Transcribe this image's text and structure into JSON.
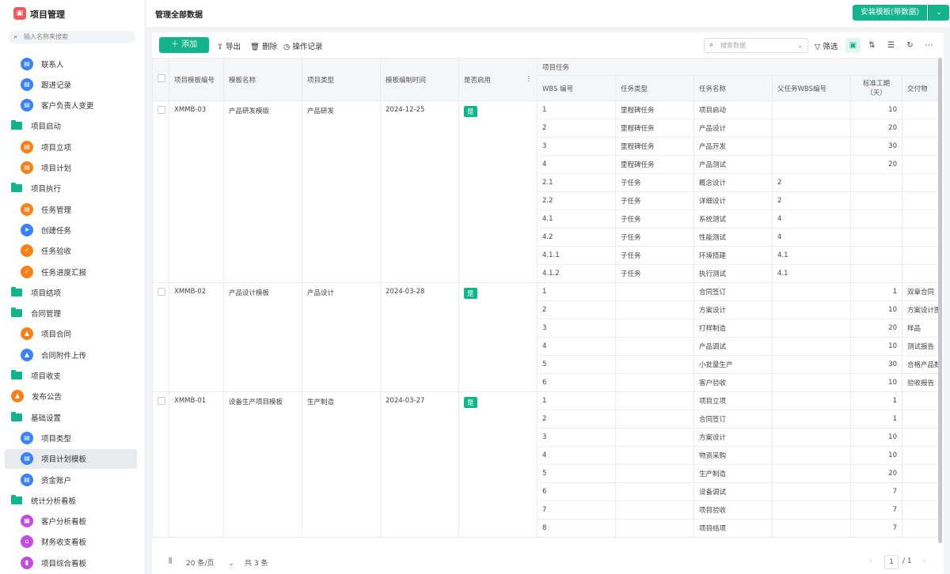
{
  "app": {
    "title": "项目管理",
    "logo_text": "▣"
  },
  "sidebar": {
    "search_placeholder": "输入名称来搜索",
    "items": [
      {
        "label": "联系人",
        "level": 1,
        "icon": "doc",
        "color": "#3b82f6"
      },
      {
        "label": "跟进记录",
        "level": 1,
        "icon": "doc",
        "color": "#3b82f6"
      },
      {
        "label": "客户负责人变更",
        "level": 1,
        "icon": "doc",
        "color": "#3b82f6"
      },
      {
        "label": "项目启动",
        "level": 0,
        "icon": "folder"
      },
      {
        "label": "项目立项",
        "level": 1,
        "icon": "doc",
        "color": "#f7821b"
      },
      {
        "label": "项目计划",
        "level": 1,
        "icon": "doc",
        "color": "#f7821b"
      },
      {
        "label": "项目执行",
        "level": 0,
        "icon": "folder"
      },
      {
        "label": "任务管理",
        "level": 1,
        "icon": "doc",
        "color": "#f7821b"
      },
      {
        "label": "创建任务",
        "level": 1,
        "icon": "send",
        "color": "#3b82f6"
      },
      {
        "label": "任务验收",
        "level": 1,
        "icon": "shield",
        "color": "#f7821b"
      },
      {
        "label": "任务进度汇报",
        "level": 1,
        "icon": "shield",
        "color": "#f7821b"
      },
      {
        "label": "项目结项",
        "level": 0,
        "icon": "folder"
      },
      {
        "label": "合同管理",
        "level": 0,
        "icon": "folder"
      },
      {
        "label": "项目合同",
        "level": 1,
        "icon": "user",
        "color": "#f7821b"
      },
      {
        "label": "合同附件上传",
        "level": 1,
        "icon": "user",
        "color": "#3b82f6"
      },
      {
        "label": "项目收支",
        "level": 0,
        "icon": "folder"
      },
      {
        "label": "发布公告",
        "level": 0,
        "icon": "user",
        "color": "#f7821b"
      },
      {
        "label": "基础设置",
        "level": 0,
        "icon": "folder"
      },
      {
        "label": "项目类型",
        "level": 1,
        "icon": "doc",
        "color": "#3b82f6"
      },
      {
        "label": "项目计划模板",
        "level": 1,
        "icon": "doc",
        "color": "#3b82f6",
        "selected": true
      },
      {
        "label": "资金账户",
        "level": 1,
        "icon": "doc",
        "color": "#3b82f6"
      },
      {
        "label": "统计分析看板",
        "level": 0,
        "icon": "folder"
      },
      {
        "label": "客户分析看板",
        "level": 1,
        "icon": "chart",
        "color": "#c24ee0"
      },
      {
        "label": "财务收支看板",
        "level": 1,
        "icon": "home",
        "color": "#c24ee0"
      },
      {
        "label": "项目综合看板",
        "level": 1,
        "icon": "bar",
        "color": "#c24ee0"
      }
    ]
  },
  "header": {
    "title": "管理全部数据",
    "install_label": "安装模板(带数据)"
  },
  "toolbar": {
    "add": "添加",
    "export": "导出",
    "delete": "删除",
    "log": "操作记录",
    "search_placeholder": "搜索数据",
    "filter": "筛选"
  },
  "table": {
    "headers": {
      "code": "项目模板编号",
      "name": "模板名称",
      "type": "项目类型",
      "date": "模板编制时间",
      "enabled": "是否启用",
      "group": "项目任务",
      "wbs": "WBS 编号",
      "task_type": "任务类型",
      "task_name": "任务名称",
      "parent": "父任务WBS编号",
      "duration": "标准工期（天）",
      "deliverable": "交付物"
    },
    "rows": [
      {
        "code": "XMMB-03",
        "name": "产品研发模版",
        "type": "产品研发",
        "date": "2024-12-25",
        "enabled": "是",
        "tasks": [
          [
            "1",
            "里程碑任务",
            "项目启动",
            "",
            "10",
            ""
          ],
          [
            "2",
            "里程碑任务",
            "产品设计",
            "",
            "20",
            ""
          ],
          [
            "3",
            "里程碑任务",
            "产品开发",
            "",
            "30",
            ""
          ],
          [
            "4",
            "里程碑任务",
            "产品测试",
            "",
            "20",
            ""
          ],
          [
            "2.1",
            "子任务",
            "概念设计",
            "2",
            "",
            ""
          ],
          [
            "2.2",
            "子任务",
            "详细设计",
            "2",
            "",
            ""
          ],
          [
            "4.1",
            "子任务",
            "系统测试",
            "4",
            "",
            ""
          ],
          [
            "4.2",
            "子任务",
            "性能测试",
            "4",
            "",
            ""
          ],
          [
            "4.1.1",
            "子任务",
            "环境搭建",
            "4.1",
            "",
            ""
          ],
          [
            "4.1.2",
            "子任务",
            "执行测试",
            "4.1",
            "",
            ""
          ]
        ]
      },
      {
        "code": "XMMB-02",
        "name": "产品设计模板",
        "type": "产品设计",
        "date": "2024-03-28",
        "enabled": "是",
        "tasks": [
          [
            "1",
            "",
            "合同签订",
            "",
            "1",
            "双章合同"
          ],
          [
            "2",
            "",
            "方案设计",
            "",
            "10",
            "方案设计图"
          ],
          [
            "3",
            "",
            "打样制造",
            "",
            "20",
            "样品"
          ],
          [
            "4",
            "",
            "产品调试",
            "",
            "10",
            "测试报告"
          ],
          [
            "5",
            "",
            "小批量生产",
            "",
            "30",
            "合格产品数"
          ],
          [
            "6",
            "",
            "客户验收",
            "",
            "10",
            "验收报告"
          ]
        ]
      },
      {
        "code": "XMMB-01",
        "name": "设备生产项目模板",
        "type": "生产制造",
        "date": "2024-03-27",
        "enabled": "是",
        "tasks": [
          [
            "1",
            "",
            "项目立项",
            "",
            "1",
            ""
          ],
          [
            "2",
            "",
            "合同签订",
            "",
            "1",
            ""
          ],
          [
            "3",
            "",
            "方案设计",
            "",
            "10",
            ""
          ],
          [
            "4",
            "",
            "物资采购",
            "",
            "10",
            ""
          ],
          [
            "5",
            "",
            "生产制造",
            "",
            "20",
            ""
          ],
          [
            "6",
            "",
            "设备调试",
            "",
            "7",
            ""
          ],
          [
            "7",
            "",
            "项目验收",
            "",
            "7",
            ""
          ],
          [
            "8",
            "",
            "项目结项",
            "",
            "7",
            ""
          ]
        ]
      }
    ]
  },
  "footer": {
    "page_size": "20 条/页",
    "total": "共 3 条",
    "page": "1",
    "pages": "/ 1"
  }
}
